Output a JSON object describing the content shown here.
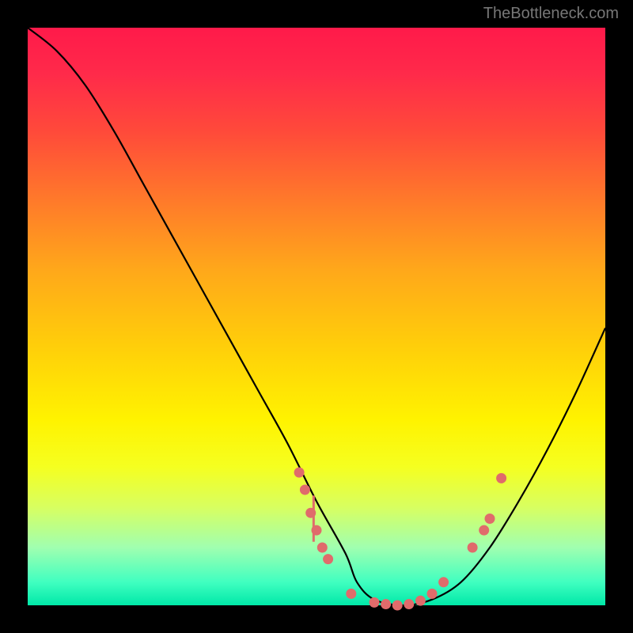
{
  "attribution": "TheBottleneck.com",
  "chart_data": {
    "type": "line",
    "title": "",
    "xlabel": "",
    "ylabel": "",
    "xlim": [
      0,
      100
    ],
    "ylim": [
      0,
      100
    ],
    "series": [
      {
        "name": "bottleneck-curve",
        "x": [
          0,
          5,
          10,
          15,
          20,
          25,
          30,
          35,
          40,
          45,
          50,
          55,
          57,
          60,
          65,
          70,
          75,
          80,
          85,
          90,
          95,
          100
        ],
        "y": [
          100,
          96,
          90,
          82,
          73,
          64,
          55,
          46,
          37,
          28,
          18,
          9,
          4,
          1,
          0,
          1,
          4,
          10,
          18,
          27,
          37,
          48
        ]
      }
    ],
    "scatter_points": {
      "name": "highlighted-points",
      "points": [
        {
          "x": 47,
          "y": 23
        },
        {
          "x": 48,
          "y": 20
        },
        {
          "x": 49,
          "y": 16
        },
        {
          "x": 50,
          "y": 13
        },
        {
          "x": 51,
          "y": 10
        },
        {
          "x": 52,
          "y": 8
        },
        {
          "x": 56,
          "y": 2
        },
        {
          "x": 60,
          "y": 0.5
        },
        {
          "x": 62,
          "y": 0.2
        },
        {
          "x": 64,
          "y": 0
        },
        {
          "x": 66,
          "y": 0.2
        },
        {
          "x": 68,
          "y": 0.8
        },
        {
          "x": 70,
          "y": 2
        },
        {
          "x": 72,
          "y": 4
        },
        {
          "x": 77,
          "y": 10
        },
        {
          "x": 79,
          "y": 13
        },
        {
          "x": 80,
          "y": 15
        },
        {
          "x": 82,
          "y": 22
        }
      ]
    },
    "error_bar": {
      "x": 49.5,
      "y_center": 15,
      "y_range": 4
    },
    "gradient_stops": [
      {
        "pos": 0,
        "color": "#ff1a4a"
      },
      {
        "pos": 50,
        "color": "#ffce0a"
      },
      {
        "pos": 75,
        "color": "#fff300"
      },
      {
        "pos": 100,
        "color": "#00e8a8"
      }
    ]
  }
}
